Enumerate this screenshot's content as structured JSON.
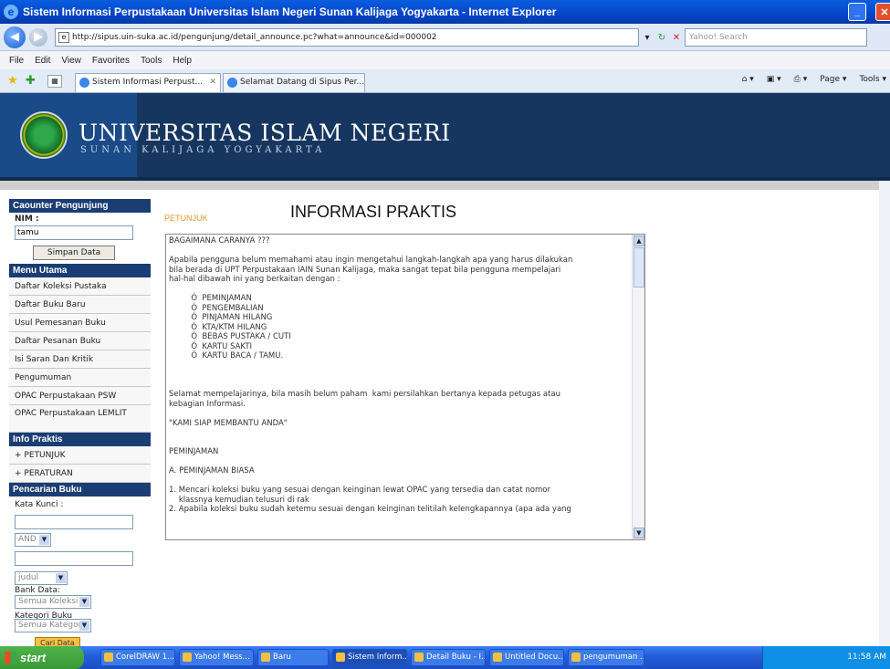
{
  "window": {
    "title": "Sistem Informasi Perpustakaan Universitas Islam Negeri Sunan Kalijaga Yogyakarta - Internet Explorer"
  },
  "address": {
    "url": "http://sipus.uin-suka.ac.id/pengunjung/detail_announce.pc?what=announce&id=000002",
    "search_placeholder": "Yahoo! Search"
  },
  "menubar": [
    "File",
    "Edit",
    "View",
    "Favorites",
    "Tools",
    "Help"
  ],
  "tabs": [
    {
      "label": "Sistem Informasi Perpust..."
    },
    {
      "label": "Selamat Datang di Sipus Per..."
    }
  ],
  "toolbar_right": {
    "page": "Page",
    "tools": "Tools"
  },
  "banner": {
    "title": "UNIVERSITAS ISLAM NEGERI",
    "subtitle": "SUNAN KALIJAGA YOGYAKARTA"
  },
  "sidebar": {
    "counter": {
      "heading": "Caounter Pengunjung",
      "nim_label": "NIM :",
      "nim_value": "tamu",
      "save_button": "Simpan Data"
    },
    "menu_utama": {
      "heading": "Menu Utama",
      "items": [
        "Daftar Koleksi Pustaka",
        "Daftar Buku Baru",
        "Usul Pemesanan Buku",
        "Daftar Pesanan Buku",
        "Isi Saran Dan Kritik",
        "Pengumuman",
        "OPAC Perpustakaan PSW",
        "OPAC Perpustakaan LEMLIT"
      ]
    },
    "info_praktis": {
      "heading": "Info Praktis",
      "items": [
        "+ PETUNJUK",
        "+ PERATURAN"
      ]
    },
    "pencarian": {
      "heading": "Pencarian Buku",
      "keyword_label": "Kata Kunci :",
      "operator": "AND",
      "field": "judul",
      "bank_label": "Bank Data:",
      "bank_value": "Semua Koleksi",
      "kategori_label": "Kategori Buku",
      "kategori_value": "Semua Kategori",
      "search_button": "Cari Data"
    }
  },
  "main": {
    "title": "INFORMASI PRAKTIS",
    "section": "PETUNJUK",
    "content": "BAGAIMANA CARANYA ???\n\nApabila pengguna belum memahami atau ingin mengetahui langkah-langkah apa yang harus dilakukan\nbila berada di UPT Perpustakaan IAIN Sunan Kalijaga, maka sangat tepat bila pengguna mempelajari\nhal-hal dibawah ini yang berkaitan dengan :\n\n         Ó  PEMINJAMAN\n         Ó  PENGEMBALIAN\n         Ó  PINJAMAN HILANG\n         Ó  KTA/KTM HILANG\n         Ó  BEBAS PUSTAKA / CUTI\n         Ó  KARTU SAKTI\n         Ó  KARTU BACA / TAMU.\n\n\n\nSelamat mempelajarinya, bila masih belum paham  kami persilahkan bertanya kepada petugas atau\nkebagian Informasi.\n\n\"KAMI SIAP MEMBANTU ANDA\"\n\n\nPEMINJAMAN\n\nA. PEMINJAMAN BIASA\n\n1. Mencari koleksi buku yang sesuai dengan keinginan lewat OPAC yang tersedia dan catat nomor\n    klassnya kemudian telusuri di rak\n2. Apabila koleksi buku sudah ketemu sesuai dengan keinginan telitilah kelengkapannya (apa ada yang"
  },
  "taskbar": {
    "start": "start",
    "tasks": [
      "CorelDRAW 1...",
      "Yahoo! Mess...",
      "Baru",
      "Sistem Inform...",
      "Detail Buku - I...",
      "Untitled Docu...",
      "pengumuman ..."
    ],
    "clock": "11:58 AM"
  }
}
